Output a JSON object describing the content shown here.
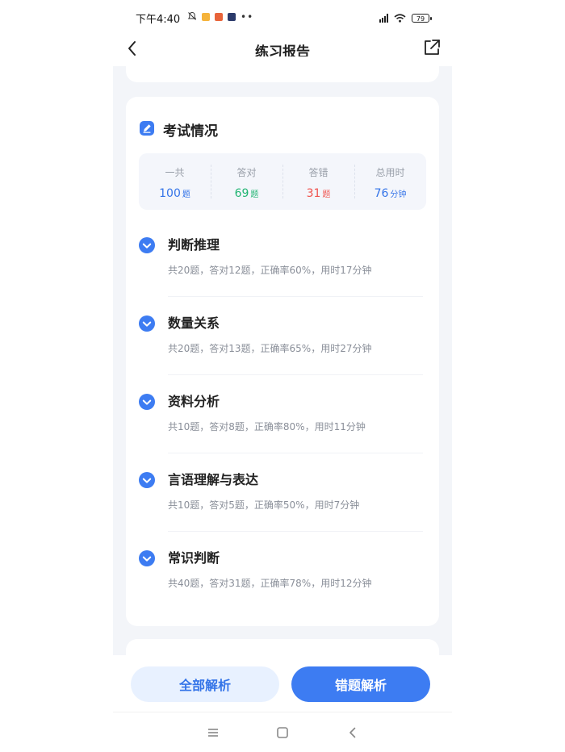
{
  "status_bar": {
    "time": "下午4:40",
    "battery": "79",
    "more": "••"
  },
  "header": {
    "title": "练习报告"
  },
  "exam": {
    "title": "考试情况",
    "summary": [
      {
        "label": "一共",
        "value": "100",
        "unit": "题",
        "color": "#3474e8"
      },
      {
        "label": "答对",
        "value": "69",
        "unit": "题",
        "color": "#22b573"
      },
      {
        "label": "答错",
        "value": "31",
        "unit": "题",
        "color": "#f0544f"
      },
      {
        "label": "总用时",
        "value": "76",
        "unit": "分钟",
        "color": "#3474e8"
      }
    ],
    "categories": [
      {
        "name": "判断推理",
        "detail": "共20题，答对12题，正确率60%，用时17分钟"
      },
      {
        "name": "数量关系",
        "detail": "共20题，答对13题，正确率65%，用时27分钟"
      },
      {
        "name": "资料分析",
        "detail": "共10题，答对8题，正确率80%，用时11分钟"
      },
      {
        "name": "言语理解与表达",
        "detail": "共10题，答对5题，正确率50%，用时7分钟"
      },
      {
        "name": "常识判断",
        "detail": "共40题，答对31题，正确率78%，用时12分钟"
      }
    ]
  },
  "actions": {
    "all_label": "全部解析",
    "wrong_label": "错题解析"
  },
  "colors": {
    "accent": "#3d7cf2",
    "correct": "#22b573",
    "wrong": "#f0544f"
  }
}
